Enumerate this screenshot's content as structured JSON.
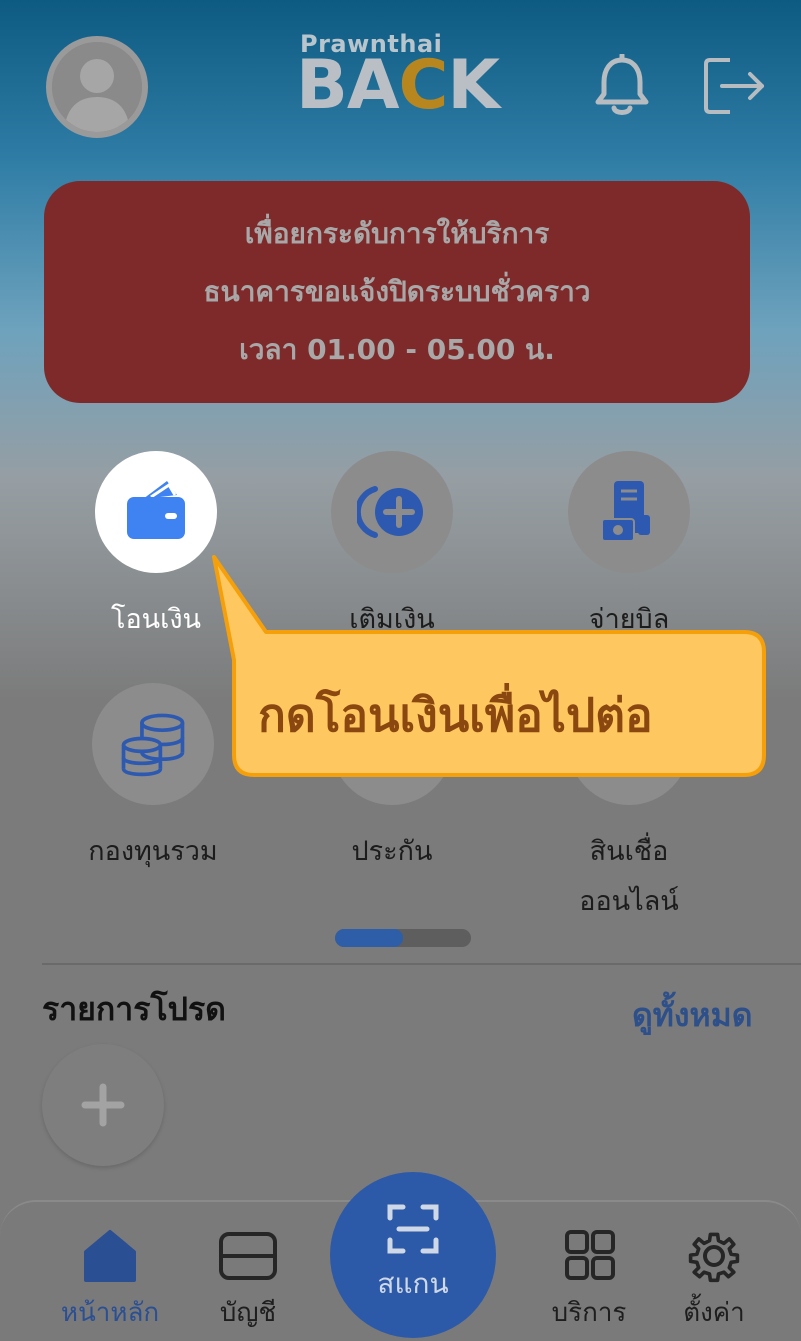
{
  "header": {
    "logo_small": "Prawnthai",
    "logo_big_a": "BA",
    "logo_big_c": "C",
    "logo_big_b": "K"
  },
  "notice": {
    "line1": "เพื่อยกระดับการให้บริการ",
    "line2": "ธนาคารขอแจ้งปิดระบบชั่วคราว",
    "line3": "เวลา 01.00 - 05.00 น."
  },
  "menu": {
    "transfer": "โอนเงิน",
    "topup": "เติมเงิน",
    "paybill": "จ่ายบิล",
    "funds": "กองทุนรวม",
    "insurance": "ประกัน",
    "loan_line1": "สินเชื่อ",
    "loan_line2": "ออนไลน์"
  },
  "pager": {
    "page": 1,
    "pages": 2
  },
  "favorites": {
    "title": "รายการโปรด",
    "see_all": "ดูทั้งหมด"
  },
  "tooltip": {
    "text": "กดโอนเงินเพื่อไปต่อ"
  },
  "nav": {
    "home": "หน้าหลัก",
    "account": "บัญชี",
    "scan": "สแกน",
    "services": "บริการ",
    "settings": "ตั้งค่า"
  },
  "colors": {
    "accent": "#2c5aa8",
    "notice_bg": "#7e2a2a",
    "tooltip_bg": "#ffc760",
    "tooltip_border": "#f5a00a",
    "tooltip_text": "#8a4710"
  }
}
